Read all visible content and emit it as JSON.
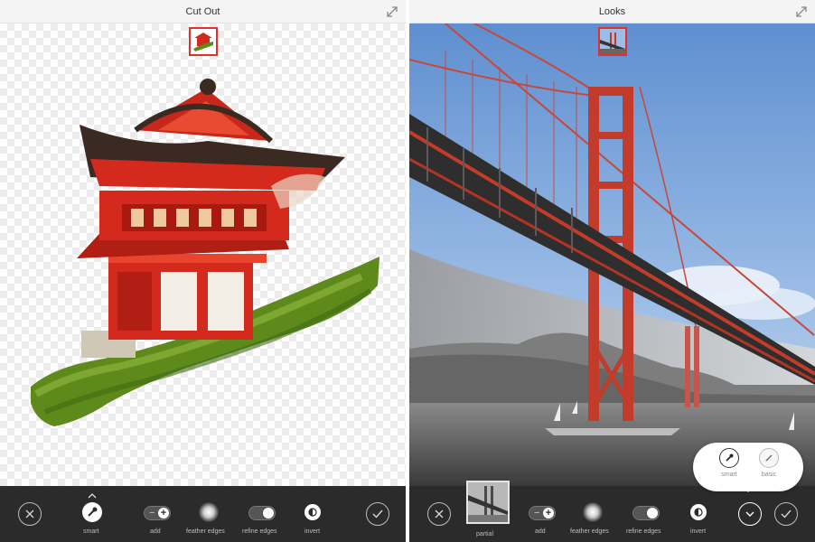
{
  "left_panel": {
    "title": "Cut Out",
    "toolbar": {
      "smart_label": "smart",
      "add_label": "add",
      "feather_label": "feather edges",
      "refine_label": "refine edges",
      "invert_label": "invert"
    }
  },
  "right_panel": {
    "title": "Looks",
    "toolbar": {
      "thumbnail_label": "partial",
      "add_label": "add",
      "feather_label": "feather edges",
      "refine_label": "refine edges",
      "invert_label": "invert"
    },
    "popover": {
      "smart_label": "smart",
      "basic_label": "basic"
    }
  },
  "colors": {
    "toolbar_bg": "#2b2b2b",
    "accent_red": "#e0312a",
    "titlebar_bg": "#f4f4f4"
  }
}
